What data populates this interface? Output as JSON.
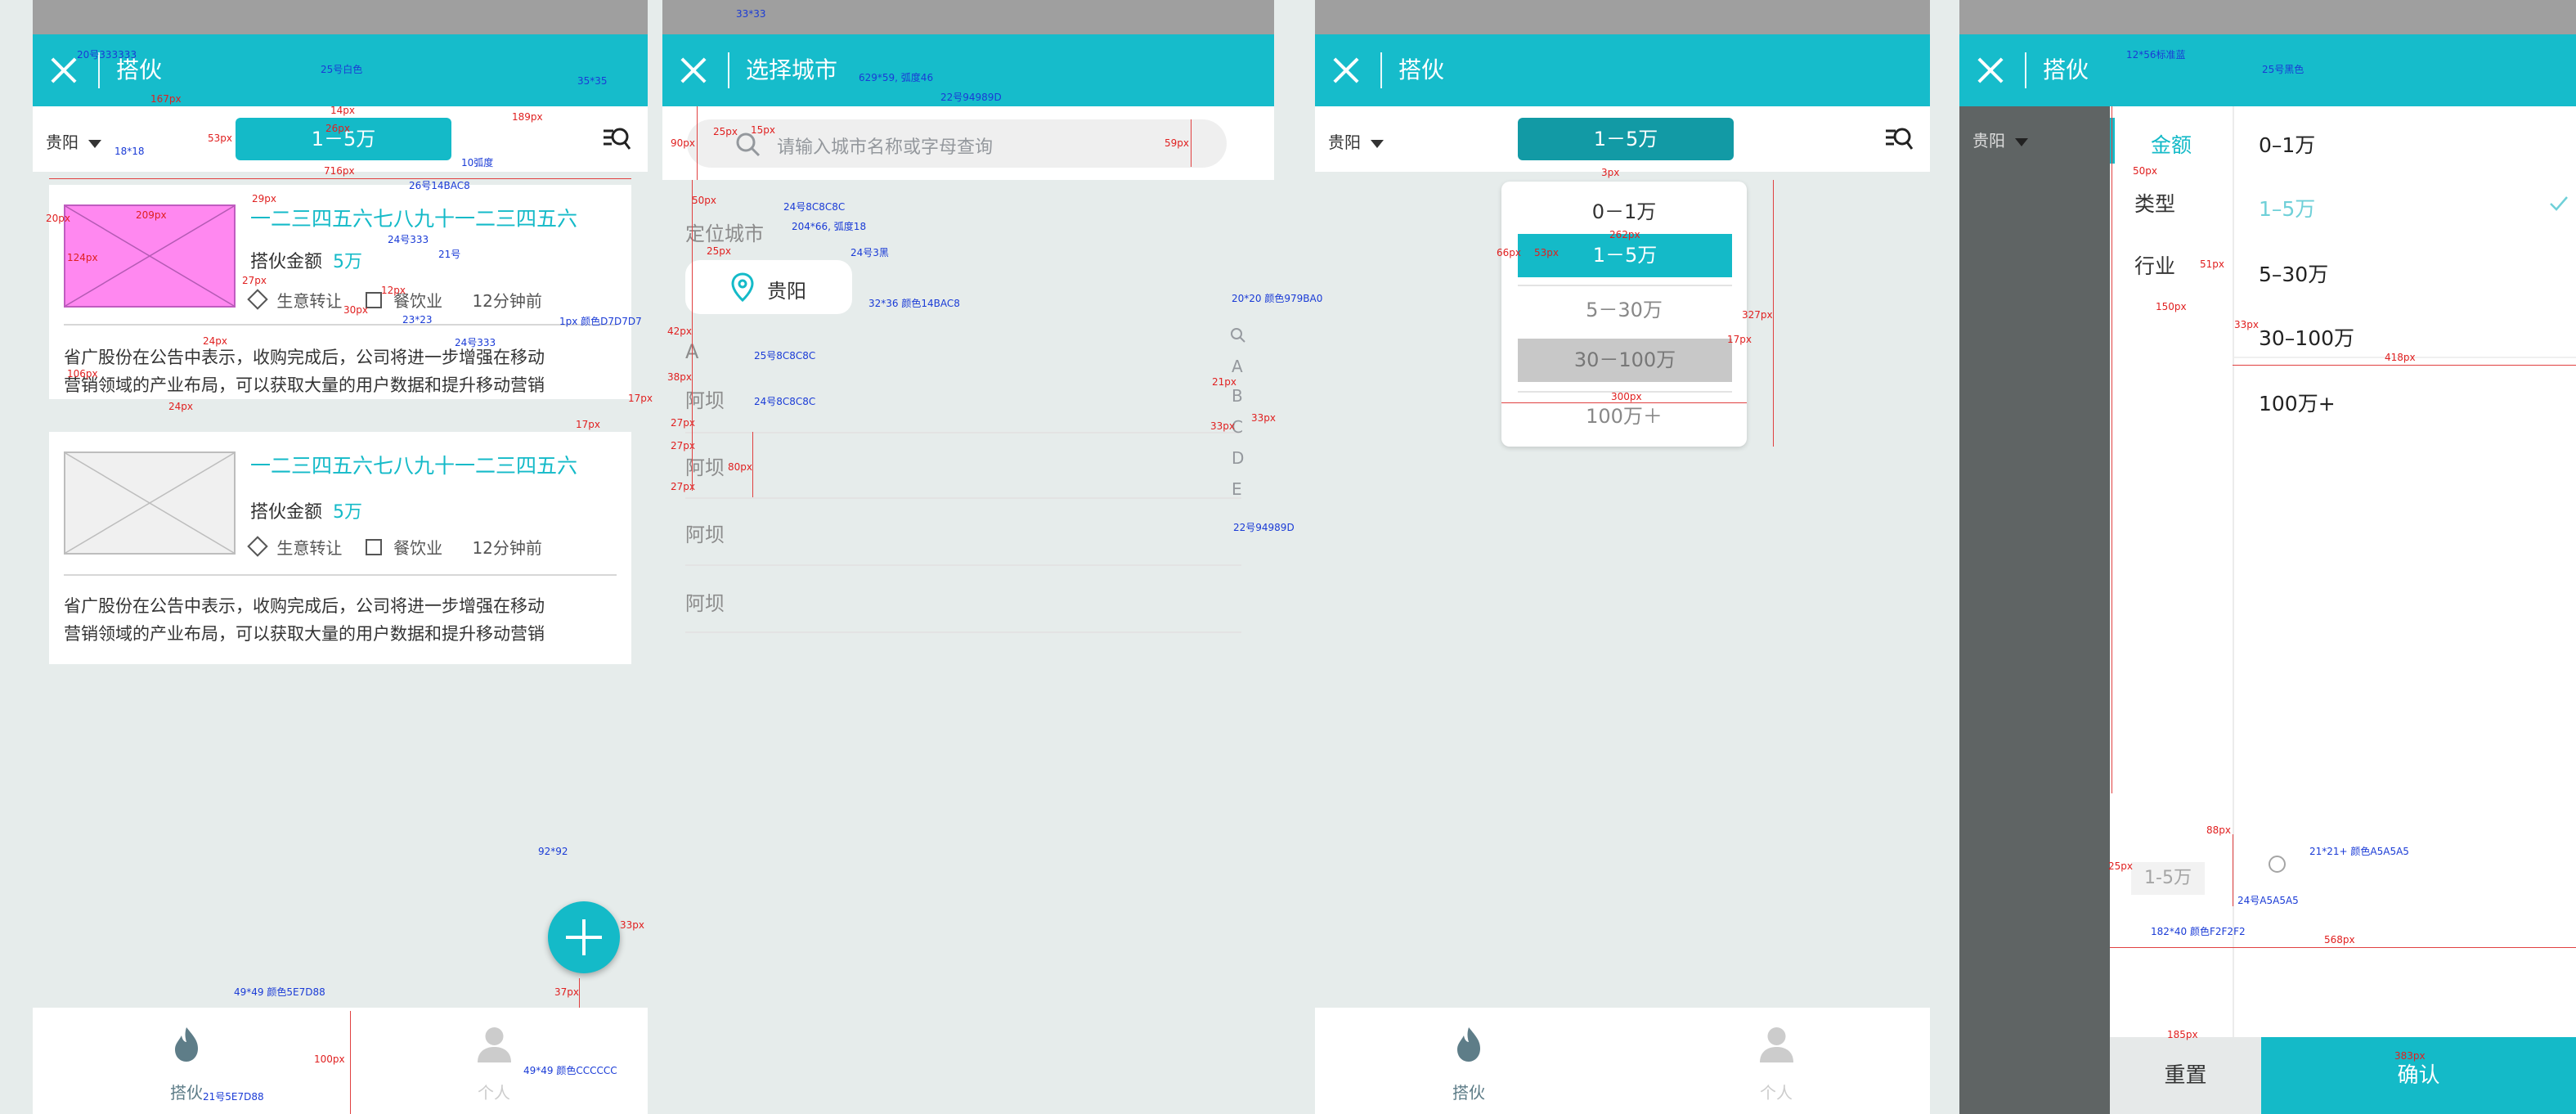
{
  "screens": {
    "feed": {
      "title": "搭伙",
      "city": "贵阳",
      "filter_value": "1－5万",
      "cards": [
        {
          "title": "一二三四五六七八九十一二三四五六",
          "amount_label": "搭伙金额",
          "amount_value": "5万",
          "tag_category": "生意转让",
          "tag_industry": "餐饮业",
          "time": "12分钟前",
          "desc_line1": "省广股份在公告中表示，收购完成后，公司将进一步增强在移动",
          "desc_line2": "营销领域的产业布局，可以获取大量的用户数据和提升移动营销"
        },
        {
          "title": "一二三四五六七八九十一二三四五六",
          "amount_label": "搭伙金额",
          "amount_value": "5万",
          "tag_category": "生意转让",
          "tag_industry": "餐饮业",
          "time": "12分钟前",
          "desc_line1": "省广股份在公告中表示，收购完成后，公司将进一步增强在移动",
          "desc_line2": "营销领域的产业布局，可以获取大量的用户数据和提升移动营销"
        }
      ],
      "nav": {
        "home": "搭伙",
        "me": "个人"
      }
    },
    "city": {
      "title": "选择城市",
      "search_placeholder": "请输入城市名称或字母查询",
      "located_label": "定位城市",
      "located_city": "贵阳",
      "section_letter": "A",
      "cities": [
        "阿坝",
        "阿坝",
        "阿坝",
        "阿坝"
      ],
      "index_letters": [
        "A",
        "B",
        "C",
        "D",
        "E"
      ]
    },
    "amount": {
      "title": "搭伙",
      "city": "贵阳",
      "filter_value": "1－5万",
      "options": [
        "0－1万",
        "1－5万",
        "5－30万",
        "30－100万",
        "100万＋"
      ],
      "nav": {
        "home": "搭伙",
        "me": "个人"
      }
    },
    "filter": {
      "title": "搭伙",
      "city": "贵阳",
      "categories": [
        "金额",
        "类型",
        "行业"
      ],
      "options": [
        "0–1万",
        "1–5万",
        "5–30万",
        "30–100万",
        "100万+"
      ],
      "selected_chip": "1-5万",
      "reset": "重置",
      "confirm": "确认"
    }
  },
  "annotations": {
    "a1": "20号333333",
    "a2": "25号白色",
    "a3": "35*35",
    "a4": "18*18",
    "a5": "10弧度",
    "a6": "26号14BAC8",
    "a7": "24号333",
    "a8": "21号",
    "a9": "23*23",
    "a10": "24号333",
    "a11": "1px 颜色D7D7D7",
    "a12": "92*92",
    "a13": "49*49 颜色5E7D88",
    "a14": "21号5E7D88",
    "a15": "49*49 颜色CCCCCC",
    "b1": "33*33",
    "b2": "629*59, 弧度46",
    "b3": "22号94989D",
    "b4": "24号8C8C8C",
    "b5": "204*66, 弧度18",
    "b6": "24号3黑",
    "b7": "32*36 颜色14BAC8",
    "b8": "25号8C8C8C",
    "b9": "24号8C8C8C",
    "b10": "20*20 颜色979BA0",
    "b11": "22号94989D",
    "d1": "12*56标准蓝",
    "d2": "25号黑色",
    "d3": "21*21+ 颜色A5A5A5",
    "d4": "24号A5A5A5",
    "d5": "182*40 颜色F2F2F2",
    "m1": "167px",
    "m2": "14px",
    "m3": "26px",
    "m4": "189px",
    "m5": "53px",
    "m6": "716px",
    "m7": "124px",
    "m8": "209px",
    "m9": "29px",
    "m10": "27px",
    "m11": "30px",
    "m12": "12px",
    "m13": "24px",
    "m14": "106px",
    "m15": "17px",
    "m16": "37px",
    "m17": "33px",
    "m18": "100px",
    "m19": "90px",
    "m20": "50px",
    "m21": "15px",
    "m22": "59px",
    "m23": "42px",
    "m24": "38px",
    "m25": "80px",
    "m26": "21px",
    "m27": "3px",
    "m28": "66px",
    "m29": "262px",
    "m30": "327px",
    "m31": "300px",
    "m32": "418px",
    "m33": "51px",
    "m34": "150px",
    "m35": "88px",
    "m36": "568px",
    "m37": "185px",
    "m38": "383px",
    "m39": "25px",
    "m40": "20px"
  },
  "colors": {
    "brand": "#14BAC8",
    "dark_teal": "#129AA5",
    "nav_active": "#5E7D88",
    "nav_inactive": "#CCCCCC",
    "selected_bg": "#C8C8C8",
    "chip_bg": "#F2F2F2",
    "pink": "#FF88F0"
  }
}
